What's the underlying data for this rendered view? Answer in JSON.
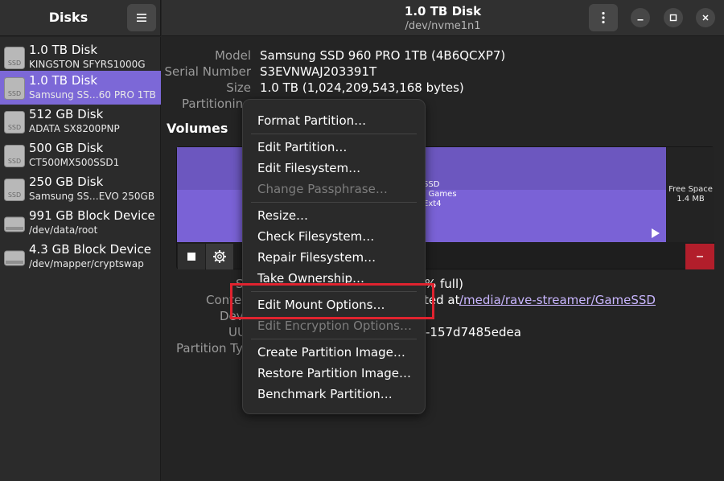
{
  "sidebar": {
    "title": "Disks",
    "menu_icon": "hamburger-menu-icon",
    "items": [
      {
        "name": "1.0 TB Disk",
        "sub": "KINGSTON SFYRS1000G",
        "icon": "SSD"
      },
      {
        "name": "1.0 TB Disk",
        "sub": "Samsung SS…60 PRO 1TB",
        "icon": "SSD"
      },
      {
        "name": "512 GB Disk",
        "sub": "ADATA SX8200PNP",
        "icon": "SSD"
      },
      {
        "name": "500 GB Disk",
        "sub": "CT500MX500SSD1",
        "icon": "SSD"
      },
      {
        "name": "250 GB Disk",
        "sub": "Samsung SS…EVO 250GB",
        "icon": "SSD"
      },
      {
        "name": "991 GB Block Device",
        "sub": "/dev/data/root",
        "icon": ""
      },
      {
        "name": "4.3 GB Block Device",
        "sub": "/dev/mapper/cryptswap",
        "icon": ""
      }
    ]
  },
  "header": {
    "title": "1.0 TB Disk",
    "subtitle": "/dev/nvme1n1"
  },
  "disk_info": {
    "model_label": "Model",
    "model_value": "Samsung SSD 960 PRO 1TB (4B6QCXP7)",
    "serial_label": "Serial Number",
    "serial_value": "S3EVNWAJ203391T",
    "size_label": "Size",
    "size_value": "1.0 TB (1,024,209,543,168 bytes)",
    "partitioning_label": "Partitioning"
  },
  "volumes": {
    "heading": "Volumes",
    "partition_text": [
      "SSD",
      ": Games",
      "Ext4"
    ],
    "free_space_label": "Free Space",
    "free_space_size": "1.4 MB",
    "details": {
      "size_label_fragment": "S",
      "size_value_fragment": "% full)",
      "contents_label_fragment": "Conte",
      "contents_value_fragment": "ted at",
      "mount_link": "/media/rave-streamer/GameSSD",
      "device_label_fragment": "Dev",
      "uuid_label_fragment": "UU",
      "uuid_value_fragment": "-157d7485edea",
      "partition_type_label_fragment": "Partition Ty"
    }
  },
  "context_menu": {
    "items": [
      {
        "label": "Format Partition…",
        "disabled": false
      },
      {
        "label": "Edit Partition…",
        "disabled": false
      },
      {
        "label": "Edit Filesystem…",
        "disabled": false
      },
      {
        "label": "Change Passphrase…",
        "disabled": true
      },
      {
        "label": "Resize…",
        "disabled": false
      },
      {
        "label": "Check Filesystem…",
        "disabled": false
      },
      {
        "label": "Repair Filesystem…",
        "disabled": false
      },
      {
        "label": "Take Ownership…",
        "disabled": false
      },
      {
        "label": "Edit Mount Options…",
        "disabled": false
      },
      {
        "label": "Edit Encryption Options…",
        "disabled": true
      },
      {
        "label": "Create Partition Image…",
        "disabled": false
      },
      {
        "label": "Restore Partition Image…",
        "disabled": false
      },
      {
        "label": "Benchmark Partition…",
        "disabled": false
      }
    ]
  },
  "colors": {
    "accent": "#7c68d7",
    "partition_fill": "#7a62d6",
    "highlight": "#e0232f",
    "danger": "#b21e2b"
  }
}
